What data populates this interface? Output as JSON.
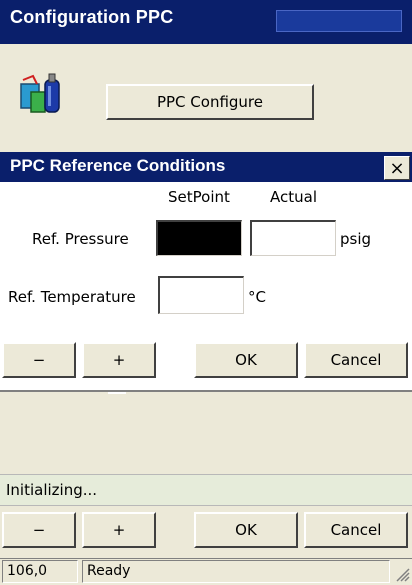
{
  "window": {
    "title": "Configuration PPC"
  },
  "toolbar": {
    "configure_label": "PPC Configure"
  },
  "dialog": {
    "title": "PPC Reference Conditions",
    "close_glyph": "×",
    "col_setpoint": "SetPoint",
    "col_actual": "Actual",
    "ref_pressure_label": "Ref. Pressure",
    "ref_pressure_unit": "psig",
    "ref_pressure_setpoint": "",
    "ref_pressure_actual": "",
    "ref_temperature_label": "Ref. Temperature",
    "ref_temperature_unit": "°C",
    "ref_temperature_value": "",
    "minus_label": "−",
    "plus_label": "+",
    "ok_label": "OK",
    "cancel_label": "Cancel"
  },
  "status": {
    "message": "Initializing..."
  },
  "bottom_buttons": {
    "minus_label": "−",
    "plus_label": "+",
    "ok_label": "OK",
    "cancel_label": "Cancel"
  },
  "statusbar": {
    "value": "106,0",
    "state": "Ready"
  },
  "colors": {
    "titlebar": "#0a1f6b",
    "face": "#ece9d8",
    "status_strip": "#e6ecda"
  },
  "icons": {
    "app": "ppc-app-icon",
    "close": "close-icon",
    "grip": "resize-grip-icon"
  }
}
